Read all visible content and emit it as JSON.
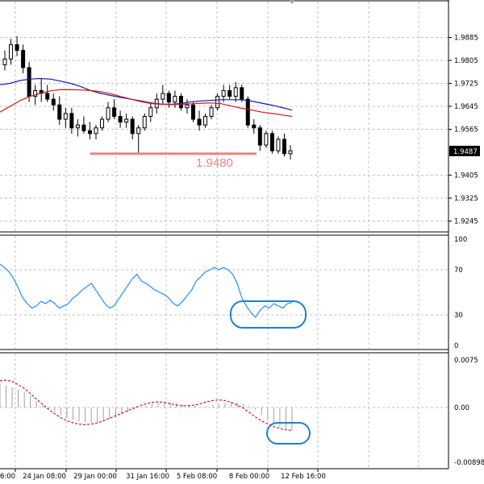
{
  "colors": {
    "candle": "#000000",
    "ma_fast": "#1a1aa6",
    "ma_slow": "#d11919",
    "support": "#f08080",
    "rsi": "#1e90ff",
    "highlight": "#1e7fd6",
    "macd_signal": "#d11919",
    "macd_hist": "#a0a0a0",
    "grid": "#c0c0c0",
    "current_price_bg": "#000000",
    "current_price_text": "#ffffff"
  },
  "price_panel": {
    "y_ticks": [
      "1.9885",
      "1.9805",
      "1.9725",
      "1.9645",
      "1.9565",
      "1.9405",
      "1.9325",
      "1.9245"
    ],
    "y_range": [
      1.921,
      2.001
    ],
    "current_price": "1.9487",
    "support_level": 1.948,
    "support_label": "1.9480"
  },
  "rsi_panel": {
    "y_ticks": [
      "100",
      "70",
      "30",
      "0"
    ],
    "y_range": [
      0,
      100
    ]
  },
  "macd_panel": {
    "y_ticks": [
      "0.0075",
      "0.00",
      "-0.00898"
    ],
    "y_range": [
      -0.0095,
      0.0085
    ]
  },
  "x_labels": [
    "6:00",
    "24 Jan 08:00",
    "29 Jan 00:00",
    "31 Jan 16:00",
    "5 Feb 08:00",
    "8 Feb 00:00",
    "12 Feb 16:00"
  ],
  "chart_data": [
    {
      "type": "candlestick",
      "ylim": [
        1.921,
        2.001
      ],
      "candles": [
        [
          1.979,
          1.984,
          1.977,
          1.981
        ],
        [
          1.981,
          1.988,
          1.979,
          1.986
        ],
        [
          1.986,
          1.989,
          1.982,
          1.984
        ],
        [
          1.984,
          1.986,
          1.976,
          1.978
        ],
        [
          1.978,
          1.98,
          1.966,
          1.968
        ],
        [
          1.968,
          1.972,
          1.965,
          1.97
        ],
        [
          1.97,
          1.974,
          1.966,
          1.969
        ],
        [
          1.969,
          1.972,
          1.966,
          1.967
        ],
        [
          1.967,
          1.969,
          1.963,
          1.965
        ],
        [
          1.965,
          1.968,
          1.958,
          1.96
        ],
        [
          1.96,
          1.964,
          1.957,
          1.962
        ],
        [
          1.962,
          1.964,
          1.955,
          1.957
        ],
        [
          1.957,
          1.96,
          1.954,
          1.958
        ],
        [
          1.958,
          1.961,
          1.955,
          1.956
        ],
        [
          1.956,
          1.959,
          1.953,
          1.955
        ],
        [
          1.955,
          1.958,
          1.953,
          1.957
        ],
        [
          1.957,
          1.961,
          1.956,
          1.96
        ],
        [
          1.96,
          1.966,
          1.959,
          1.964
        ],
        [
          1.964,
          1.967,
          1.96,
          1.961
        ],
        [
          1.961,
          1.963,
          1.957,
          1.959
        ],
        [
          1.959,
          1.962,
          1.957,
          1.96
        ],
        [
          1.96,
          1.961,
          1.953,
          1.955
        ],
        [
          1.955,
          1.958,
          1.948,
          1.957
        ],
        [
          1.957,
          1.962,
          1.956,
          1.961
        ],
        [
          1.961,
          1.966,
          1.959,
          1.964
        ],
        [
          1.964,
          1.969,
          1.962,
          1.967
        ],
        [
          1.967,
          1.972,
          1.965,
          1.969
        ],
        [
          1.969,
          1.97,
          1.964,
          1.966
        ],
        [
          1.966,
          1.97,
          1.964,
          1.968
        ],
        [
          1.968,
          1.969,
          1.963,
          1.964
        ],
        [
          1.964,
          1.967,
          1.962,
          1.965
        ],
        [
          1.965,
          1.966,
          1.959,
          1.96
        ],
        [
          1.96,
          1.963,
          1.956,
          1.958
        ],
        [
          1.958,
          1.962,
          1.957,
          1.961
        ],
        [
          1.961,
          1.965,
          1.96,
          1.964
        ],
        [
          1.964,
          1.969,
          1.963,
          1.968
        ],
        [
          1.968,
          1.972,
          1.966,
          1.97
        ],
        [
          1.97,
          1.972,
          1.967,
          1.968
        ],
        [
          1.968,
          1.973,
          1.966,
          1.971
        ],
        [
          1.971,
          1.972,
          1.966,
          1.967
        ],
        [
          1.967,
          1.968,
          1.957,
          1.958
        ],
        [
          1.958,
          1.96,
          1.955,
          1.957
        ],
        [
          1.957,
          1.958,
          1.949,
          1.951
        ],
        [
          1.951,
          1.956,
          1.95,
          1.955
        ],
        [
          1.955,
          1.956,
          1.948,
          1.949
        ],
        [
          1.949,
          1.954,
          1.948,
          1.953
        ],
        [
          1.953,
          1.955,
          1.947,
          1.948
        ],
        [
          1.948,
          1.951,
          1.946,
          1.949
        ]
      ],
      "ma_fast": [
        1.972,
        1.9725,
        1.9735,
        1.974,
        1.9742,
        1.974,
        1.9733,
        1.9725,
        1.9714,
        1.97,
        1.969,
        1.9683,
        1.9676,
        1.967,
        1.9664,
        1.9657,
        1.9653,
        1.9652,
        1.9655,
        1.9661,
        1.9664,
        1.9666,
        1.9668,
        1.9668,
        1.9668,
        1.9663,
        1.9656,
        1.9649,
        1.9641,
        1.9632
      ],
      "ma_slow": [
        1.9625,
        1.9645,
        1.9665,
        1.968,
        1.969,
        1.9699,
        1.9703,
        1.9703,
        1.9702,
        1.97,
        1.9696,
        1.9689,
        1.9679,
        1.967,
        1.9661,
        1.9655,
        1.9652,
        1.9651,
        1.9652,
        1.9654,
        1.9656,
        1.9657,
        1.9654,
        1.9646,
        1.9638,
        1.9632,
        1.9625,
        1.962,
        1.9615,
        1.961
      ],
      "support_level": 1.948,
      "current_price": 1.9487
    },
    {
      "type": "line",
      "ylabel": "",
      "ylim": [
        0,
        100
      ],
      "values": [
        75,
        72,
        68,
        62,
        54,
        45,
        40,
        36,
        38,
        42,
        40,
        43,
        40,
        36,
        38,
        40,
        45,
        48,
        52,
        55,
        58,
        52,
        46,
        40,
        36,
        38,
        44,
        50,
        56,
        62,
        66,
        60,
        58,
        55,
        52,
        50,
        48,
        45,
        40,
        38,
        42,
        47,
        52,
        60,
        64,
        68,
        70,
        72,
        70,
        72,
        70,
        66,
        58,
        45,
        38,
        32,
        28,
        34,
        38,
        36,
        40,
        38,
        36,
        40,
        41
      ]
    },
    {
      "type": "bar_line",
      "ylim": [
        -0.0095,
        0.0085
      ],
      "histogram": [
        0.0038,
        0.0035,
        0.0032,
        0.0028,
        0.0024,
        0.0018,
        0.001,
        0.0004,
        -0.0002,
        -0.0007,
        -0.0012,
        -0.0016,
        -0.0019,
        -0.0021,
        -0.0023,
        -0.0024,
        -0.0023,
        -0.0021,
        -0.0018,
        -0.0015,
        -0.0011,
        -0.0007,
        -0.0004,
        0.0,
        0.0003,
        0.0006,
        0.0008,
        0.0009,
        0.0008,
        0.0007,
        0.0005,
        0.0004,
        0.0003,
        0.0001,
        0.0002,
        0.0004,
        0.0006,
        0.0008,
        0.0009,
        0.0008,
        0.0006,
        0.0002,
        -0.0004,
        -0.0012,
        -0.002,
        -0.0026,
        -0.003,
        -0.0033,
        -0.0036
      ],
      "signal": [
        0.0042,
        0.0043,
        0.0041,
        0.0036,
        0.003,
        0.0022,
        0.0013,
        0.0005,
        -0.0003,
        -0.001,
        -0.0016,
        -0.0021,
        -0.0024,
        -0.0026,
        -0.0027,
        -0.0026,
        -0.0024,
        -0.0021,
        -0.0017,
        -0.0013,
        -0.0009,
        -0.0005,
        -0.0001,
        0.0003,
        0.0006,
        0.0008,
        0.0009,
        0.0008,
        0.0006,
        0.0004,
        0.0003,
        0.0003,
        0.0004,
        0.0006,
        0.0009,
        0.0011,
        0.0012,
        0.0011,
        0.0008,
        0.0004,
        -0.0001,
        -0.0008,
        -0.0015,
        -0.0021,
        -0.0026,
        -0.003,
        -0.0033,
        -0.0035,
        -0.0036
      ]
    }
  ]
}
